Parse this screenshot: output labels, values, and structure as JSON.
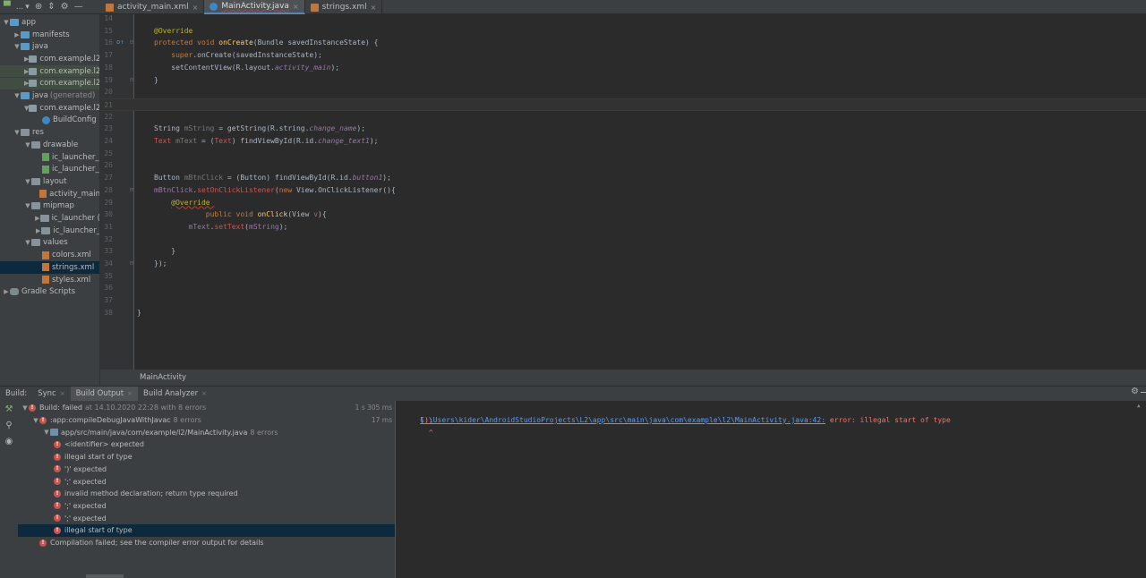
{
  "toolbar": {
    "project_dropdown": "...",
    "tabs": [
      {
        "label": "activity_main.xml",
        "type": "xml",
        "active": false
      },
      {
        "label": "MainActivity.java",
        "type": "java",
        "active": true
      },
      {
        "label": "strings.xml",
        "type": "xml",
        "active": false
      }
    ]
  },
  "project_tree": [
    {
      "label": "app",
      "depth": 0,
      "arrow": "down",
      "icon": "folder-blue"
    },
    {
      "label": "manifests",
      "depth": 1,
      "arrow": "right",
      "icon": "folder-blue"
    },
    {
      "label": "java",
      "depth": 1,
      "arrow": "down",
      "icon": "folder-blue"
    },
    {
      "label": "com.example.l2",
      "depth": 2,
      "arrow": "right",
      "icon": "package"
    },
    {
      "label": "com.example.l2",
      "depth": 2,
      "arrow": "right",
      "icon": "package",
      "highlight": true
    },
    {
      "label": "com.example.l2",
      "depth": 2,
      "arrow": "right",
      "icon": "package",
      "highlight": true
    },
    {
      "label": "java",
      "sub": "(generated)",
      "depth": 1,
      "arrow": "down",
      "icon": "folder-blue"
    },
    {
      "label": "com.example.l2",
      "depth": 2,
      "arrow": "down",
      "icon": "package"
    },
    {
      "label": "BuildConfig",
      "depth": 3,
      "arrow": "",
      "icon": "class"
    },
    {
      "label": "res",
      "depth": 1,
      "arrow": "down",
      "icon": "folder"
    },
    {
      "label": "drawable",
      "depth": 2,
      "arrow": "down",
      "icon": "folder"
    },
    {
      "label": "ic_launcher_",
      "depth": 3,
      "arrow": "",
      "icon": "png"
    },
    {
      "label": "ic_launcher_",
      "depth": 3,
      "arrow": "",
      "icon": "png"
    },
    {
      "label": "layout",
      "depth": 2,
      "arrow": "down",
      "icon": "folder"
    },
    {
      "label": "activity_main",
      "depth": 3,
      "arrow": "",
      "icon": "xml"
    },
    {
      "label": "mipmap",
      "depth": 2,
      "arrow": "down",
      "icon": "folder"
    },
    {
      "label": "ic_launcher (",
      "depth": 3,
      "arrow": "right",
      "icon": "folder"
    },
    {
      "label": "ic_launcher_",
      "depth": 3,
      "arrow": "right",
      "icon": "folder"
    },
    {
      "label": "values",
      "depth": 2,
      "arrow": "down",
      "icon": "folder"
    },
    {
      "label": "colors.xml",
      "depth": 3,
      "arrow": "",
      "icon": "xml"
    },
    {
      "label": "strings.xml",
      "depth": 3,
      "arrow": "",
      "icon": "xml",
      "selected": true
    },
    {
      "label": "styles.xml",
      "depth": 3,
      "arrow": "",
      "icon": "xml"
    },
    {
      "label": "Gradle Scripts",
      "depth": 0,
      "arrow": "right",
      "icon": "gradle"
    }
  ],
  "editor": {
    "lines": [
      {
        "n": "14",
        "html": ""
      },
      {
        "n": "15",
        "html": "<span class='an'>@Override</span>"
      },
      {
        "n": "16",
        "html": "<span class='kw'>protected void </span><span class='fn'>onCreate</span>(Bundle savedInstanceState) {",
        "mark": "o↑"
      },
      {
        "n": "17",
        "html": "    <span class='kw'>super</span>.onCreate(savedInstanceState);"
      },
      {
        "n": "18",
        "html": "    setContentView(R.layout.<span class='fi'>activity_main</span>);"
      },
      {
        "n": "19",
        "html": "}"
      },
      {
        "n": "20",
        "html": ""
      },
      {
        "n": "21",
        "html": "",
        "current": true
      },
      {
        "n": "22",
        "html": ""
      },
      {
        "n": "23",
        "html": "String <span class='gray'>mString</span> = getString(R.string.<span class='fi'>change_name</span>);"
      },
      {
        "n": "24",
        "html": "<span class='red'>Text</span> <span class='gray'>mText</span> = (<span class='red'>Text</span>) findViewById(R.id.<span class='fi'>change_text1</span>);"
      },
      {
        "n": "25",
        "html": ""
      },
      {
        "n": "26",
        "html": ""
      },
      {
        "n": "27",
        "html": "Button <span class='gray'>mBtnClick</span> = (Button) findViewById(R.id.<span class='fi'>button1</span>);"
      },
      {
        "n": "28",
        "html": "<span class='pf'>mBtnClick</span>.<span class='red'>setOnClickListener</span>(<span class='kw'>new </span>View.OnClickListener(){"
      },
      {
        "n": "29",
        "html": "    <span class='an err'>@Override </span>"
      },
      {
        "n": "30",
        "html": "            <span class='kw'>public void </span><span class='fn'>onClick</span>(View <span class='red'>v</span>){"
      },
      {
        "n": "31",
        "html": "        <span class='pf'>mText</span>.<span class='red'>setText</span>(<span class='pf'>mString</span>);"
      },
      {
        "n": "32",
        "html": ""
      },
      {
        "n": "33",
        "html": "    }"
      },
      {
        "n": "34",
        "html": "});"
      },
      {
        "n": "35",
        "html": ""
      },
      {
        "n": "36",
        "html": ""
      },
      {
        "n": "37",
        "html": ""
      },
      {
        "n": "38",
        "html": "}",
        "outdent": true
      }
    ]
  },
  "breadcrumb": "MainActivity",
  "bottom_panel": {
    "build_label": "Build:",
    "tabs": [
      {
        "label": "Sync",
        "active": false
      },
      {
        "label": "Build Output",
        "active": true
      },
      {
        "label": "Build Analyzer",
        "active": false
      }
    ],
    "build_tree": [
      {
        "text": "Build:",
        "bold_part": "failed",
        "sub": "at 14.10.2020 22:28 with 8 errors",
        "time": "1 s 305 ms",
        "depth": 0,
        "arrow": "down"
      },
      {
        "text": ":app:compileDebugJavaWithJavac",
        "sub": "8 errors",
        "time": "17 ms",
        "depth": 1,
        "arrow": "down"
      },
      {
        "text": "app/src/main/java/com/example/l2/MainActivity.java",
        "sub": "8 errors",
        "depth": 2,
        "arrow": "down",
        "file": true
      },
      {
        "text": "<identifier> expected",
        "depth": 3
      },
      {
        "text": "illegal start of type",
        "depth": 3
      },
      {
        "text": "')' expected",
        "depth": 3
      },
      {
        "text": "';' expected",
        "depth": 3
      },
      {
        "text": "invalid method declaration; return type required",
        "depth": 3
      },
      {
        "text": "';' expected",
        "depth": 3
      },
      {
        "text": "';' expected",
        "depth": 3
      },
      {
        "text": "illegal start of type",
        "depth": 3,
        "selected": true
      },
      {
        "text": "Compilation failed; see the compiler error output for details",
        "depth": 1
      }
    ],
    "console": {
      "path_link": "C:\\Users\\kider\\AndroidStudioProjects\\L2\\app\\src\\main\\java\\com\\example\\l2\\MainActivity.java:42:",
      "error_text": " error: illegal start of type",
      "line2": "    });",
      "line3": "      ^"
    }
  }
}
